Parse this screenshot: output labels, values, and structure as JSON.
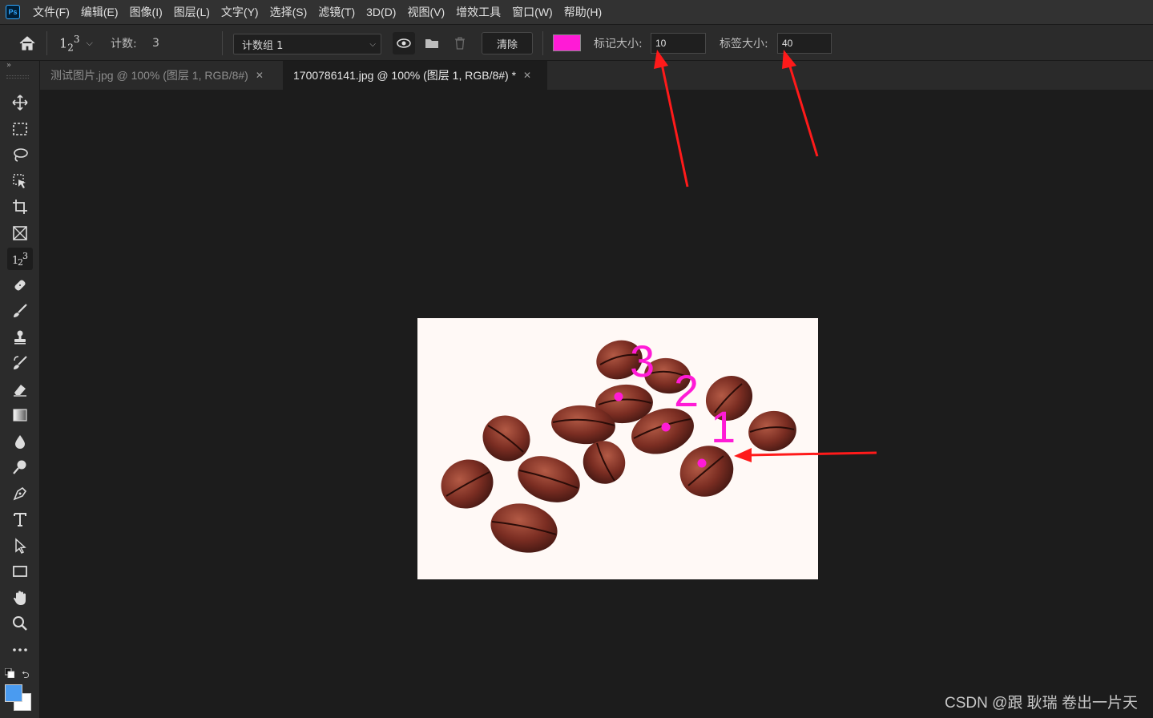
{
  "menu": [
    "文件(F)",
    "编辑(E)",
    "图像(I)",
    "图层(L)",
    "文字(Y)",
    "选择(S)",
    "滤镜(T)",
    "3D(D)",
    "视图(V)",
    "增效工具",
    "窗口(W)",
    "帮助(H)"
  ],
  "app_logo": "Ps",
  "options": {
    "count_tool_glyph": "123",
    "count_label": "计数:",
    "count_value": "3",
    "group_select": "计数组 1",
    "clear_label": "清除",
    "marker_color": "#ff1bd6",
    "mark_size_label": "标记大小:",
    "mark_size_value": "10",
    "label_size_label": "标签大小:",
    "label_size_value": "40"
  },
  "tabs": [
    {
      "title": "测试图片.jpg @ 100% (图层 1, RGB/8#)",
      "active": false
    },
    {
      "title": "1700786141.jpg @ 100% (图层 1, RGB/8#) *",
      "active": true
    }
  ],
  "tools": [
    "move-tool-icon",
    "marquee-tool-icon",
    "lasso-tool-icon",
    "object-select-tool-icon",
    "crop-tool-icon",
    "frame-tool-icon",
    "count-tool-icon",
    "healing-brush-tool-icon",
    "brush-tool-icon",
    "stamp-tool-icon",
    "history-brush-tool-icon",
    "eraser-tool-icon",
    "gradient-tool-icon",
    "blur-tool-icon",
    "dodge-tool-icon",
    "pen-tool-icon",
    "type-tool-icon",
    "path-select-tool-icon",
    "rectangle-tool-icon",
    "hand-tool-icon",
    "zoom-tool-icon",
    "more-tools-icon"
  ],
  "colors": {
    "foreground": "#4a9bf0",
    "background": "#ffffff",
    "arrow": "#ff1a1a"
  },
  "canvas": {
    "count_labels": [
      "1",
      "2",
      "3"
    ]
  },
  "watermark": "CSDN @跟 耿瑞 卷出一片天"
}
